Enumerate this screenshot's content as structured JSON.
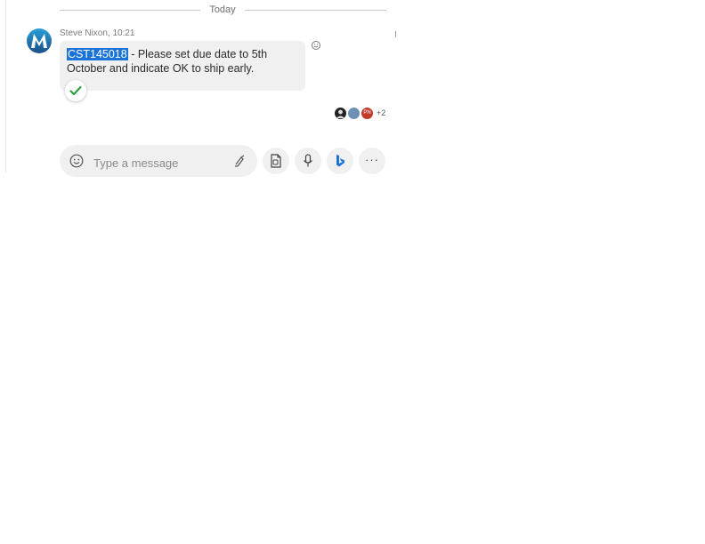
{
  "divider": {
    "label": "Today"
  },
  "message": {
    "sender": "Steve Nixon",
    "time": "10:21",
    "sender_line": "Steve Nixon, 10:21",
    "highlight": "CST145018",
    "body": " - Please set due date to 5th October and indicate OK to ship early.",
    "status": "delivered"
  },
  "read_receipts": {
    "avatars": [
      {
        "name": "dark-avatar",
        "color": "#222222",
        "initials": ""
      },
      {
        "name": "blue-avatar",
        "color": "#6f8fb5",
        "initials": ""
      },
      {
        "name": "red-avatar",
        "color": "#c0392b",
        "initials": "PN"
      }
    ],
    "more": "+2"
  },
  "composer": {
    "placeholder": "Type a message",
    "value": ""
  },
  "toolbar": {
    "icons": [
      "emoji-icon",
      "format-icon",
      "attach-file-icon",
      "microphone-icon",
      "bing-icon",
      "more-options-icon"
    ]
  },
  "colors": {
    "highlight": "#1a73d9",
    "bubble": "#f0f0f0",
    "check": "#2ea043",
    "bing": "#1a73d9"
  }
}
